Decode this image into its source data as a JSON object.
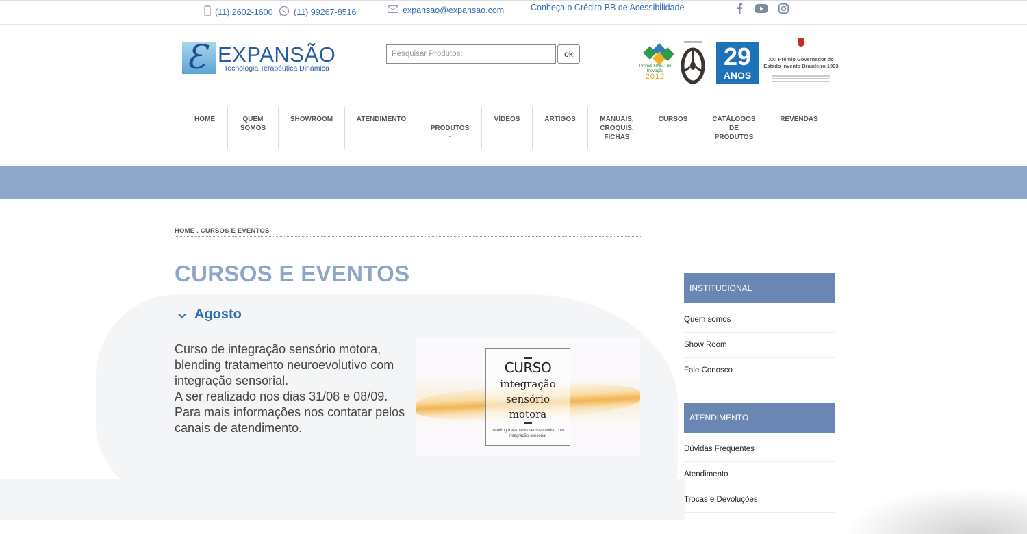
{
  "topbar": {
    "phone1": "(11) 2602-1600",
    "phone2": "(11) 99267-8516",
    "email": "expansao@expansao.com",
    "accessibility_link": "Conheça o Crédito BB de Acessibilidade",
    "social": [
      "facebook-icon",
      "youtube-icon",
      "instagram-icon"
    ]
  },
  "header": {
    "logo_brand": "EXPANSÃO",
    "logo_tagline": "Tecnologia Terapêutica Dinâmica",
    "search_placeholder": "Pesquisar Produtos:",
    "search_button": "ok",
    "awards": {
      "finep_label": "Prêmio FINEP de Inovação",
      "finep_year": "2012",
      "anos_number": "29",
      "anos_label": "ANOS",
      "premio_text": "XXI Prêmio Governador do Estado Invento Brasileiro 1993"
    }
  },
  "nav": [
    "HOME",
    "QUEM\nSOMOS",
    "SHOWROOM",
    "ATENDIMENTO",
    "PRODUTOS",
    "VÍDEOS",
    "ARTIGOS",
    "MANUAIS,\nCROQUIS,\nFICHAS",
    "CURSOS",
    "CATÁLOGOS\nDE PRODUTOS",
    "REVENDAS"
  ],
  "breadcrumb": "HOME . CURSOS E EVENTOS",
  "page_title": "CURSOS E EVENTOS",
  "accordion": {
    "label": "Agosto",
    "description_lines": [
      "Curso de integração sensório motora, blending tratamento neuroevolutivo com integração sensorial.",
      "A ser realizado nos dias 31/08 e 08/09.",
      "Para mais informações nos contatar pelos canais de atendimento."
    ]
  },
  "poster": {
    "title": "CURSO",
    "subtitle": "integração sensório motora",
    "caption": "blending tratamento neuroevolutivo com integração sensorial"
  },
  "sidebar": {
    "sections": [
      {
        "title": "INSTITUCIONAL",
        "links": [
          "Quem somos",
          "Show Room",
          "Fale Conosco"
        ]
      },
      {
        "title": "ATENDIMENTO",
        "links": [
          "Dúvidas Frequentes",
          "Atendimento",
          "Trocas e Devoluções"
        ]
      }
    ]
  },
  "colors": {
    "accent": "#2f6fb1",
    "band": "#8ca7c8",
    "sidebar_header": "#6a87b4",
    "title": "#8ca7c8"
  }
}
